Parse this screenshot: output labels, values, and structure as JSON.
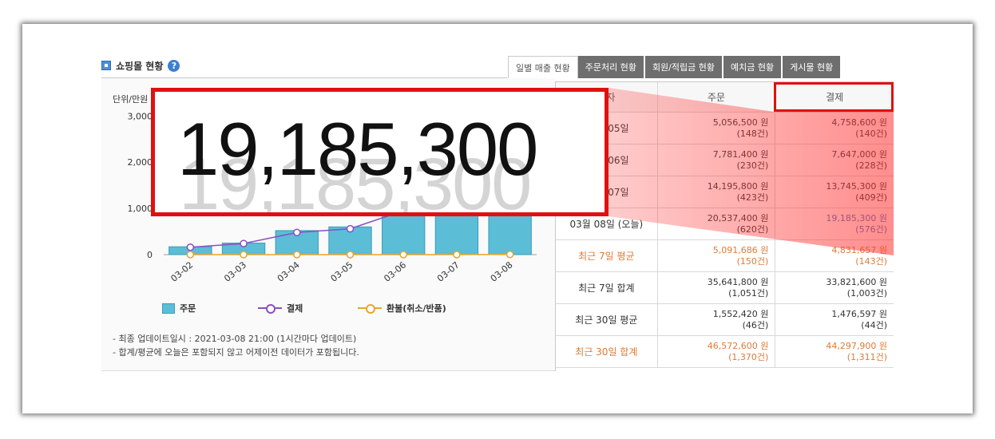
{
  "panel": {
    "title": "쇼핑몰 현황",
    "help": "?"
  },
  "tabs": [
    {
      "label": "일별 매출 현황",
      "active": true
    },
    {
      "label": "주문처리 현황",
      "active": false
    },
    {
      "label": "회원/적립금 현황",
      "active": false
    },
    {
      "label": "예치금 현황",
      "active": false
    },
    {
      "label": "게시물 현황",
      "active": false
    }
  ],
  "chart": {
    "unit_label": "단위/만원",
    "legend": {
      "bar": "주문",
      "line1": "결제",
      "line2": "환불(취소/반품)"
    }
  },
  "chart_data": {
    "type": "bar",
    "categories": [
      "03-02",
      "03-03",
      "03-04",
      "03-05",
      "03-06",
      "03-07",
      "03-08"
    ],
    "series": [
      {
        "name": "주문",
        "type": "bar",
        "values": [
          170,
          250,
          520,
          600,
          980,
          1420,
          2054
        ]
      },
      {
        "name": "결제",
        "type": "line",
        "values": [
          160,
          240,
          480,
          560,
          950,
          1370,
          1919
        ]
      },
      {
        "name": "환불(취소/반품)",
        "type": "line",
        "values": [
          0,
          0,
          0,
          0,
          0,
          0,
          5
        ]
      }
    ],
    "yticks": [
      0,
      1000,
      2000,
      3000
    ],
    "ytick_labels": [
      "0",
      "1,000",
      "2,000",
      "3,000"
    ],
    "ylim": [
      0,
      3300
    ],
    "colors": {
      "bar": "#5bbdd6",
      "line1": "#8a4fc4",
      "line2": "#e8a628"
    }
  },
  "notes": [
    "- 최종 업데이트일시 : 2021-03-08 21:00 (1시간마다 업데이트)",
    "- 합계/평균에 오늘은 포함되지 않고 어제이전 데이터가 포함됩니다."
  ],
  "table": {
    "headers": [
      "일자",
      "주문",
      "결제"
    ],
    "rows": [
      {
        "label": "03월 05일",
        "order_amt": "5,056,500 원",
        "order_cnt": "(148건)",
        "pay_amt": "4,758,600 원",
        "pay_cnt": "(140건)",
        "style": "normal"
      },
      {
        "label": "03월 06일",
        "order_amt": "7,781,400 원",
        "order_cnt": "(230건)",
        "pay_amt": "7,647,000 원",
        "pay_cnt": "(228건)",
        "style": "normal"
      },
      {
        "label": "03월 07일",
        "order_amt": "14,195,800 원",
        "order_cnt": "(423건)",
        "pay_amt": "13,745,300 원",
        "pay_cnt": "(409건)",
        "style": "normal"
      },
      {
        "label": "03월 08일 (오늘)",
        "order_amt": "20,537,400 원",
        "order_cnt": "(620건)",
        "pay_amt": "19,185,300 원",
        "pay_cnt": "(576건)",
        "style": "today"
      },
      {
        "label": "최근 7일 평균",
        "order_amt": "5,091,686 원",
        "order_cnt": "(150건)",
        "pay_amt": "4,831,657 원",
        "pay_cnt": "(143건)",
        "style": "orange"
      },
      {
        "label": "최근 7일 합계",
        "order_amt": "35,641,800 원",
        "order_cnt": "(1,051건)",
        "pay_amt": "33,821,600 원",
        "pay_cnt": "(1,003건)",
        "style": "normal"
      },
      {
        "label": "최근 30일 평균",
        "order_amt": "1,552,420 원",
        "order_cnt": "(46건)",
        "pay_amt": "1,476,597 원",
        "pay_cnt": "(44건)",
        "style": "normal"
      },
      {
        "label": "최근 30일 합계",
        "order_amt": "46,572,600 원",
        "order_cnt": "(1,370건)",
        "pay_amt": "44,297,900 원",
        "pay_cnt": "(1,311건)",
        "style": "orange"
      }
    ]
  },
  "zoom": {
    "value": "19,185,300"
  },
  "colors": {
    "highlight": "#e01010",
    "orange_text": "#e07a36",
    "blue_text": "#3f79c6",
    "tab_inactive": "#6e6e6e"
  }
}
